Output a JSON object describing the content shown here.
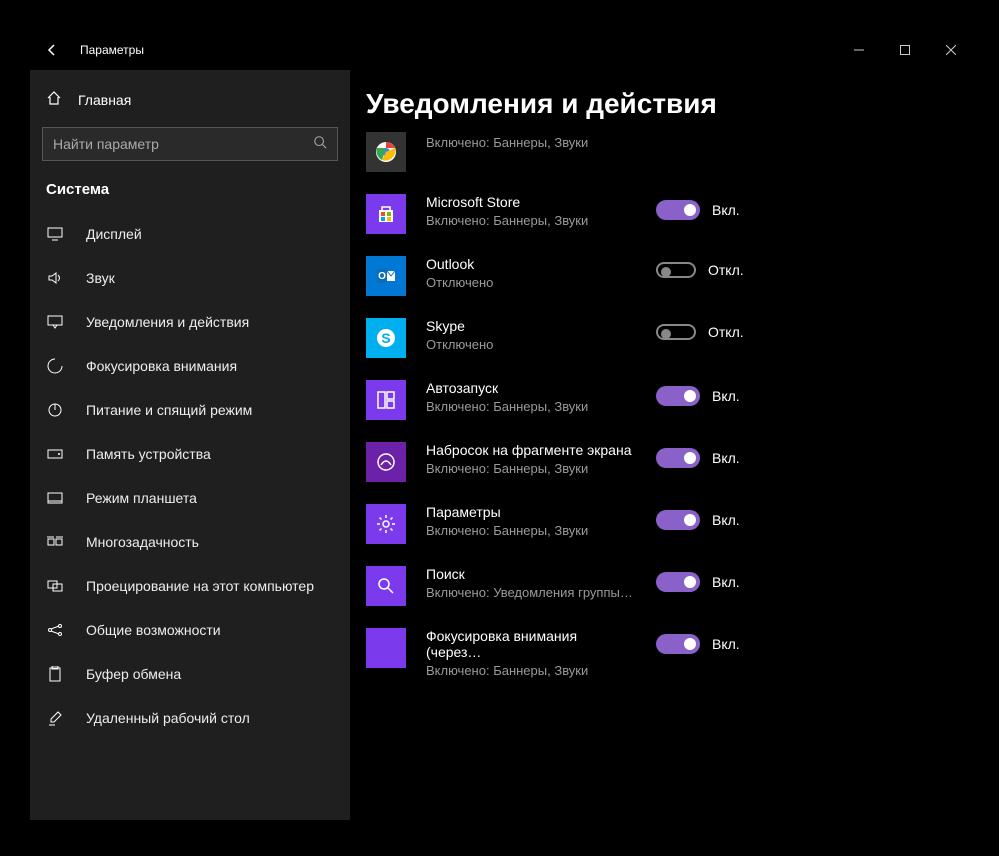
{
  "titlebar": {
    "title": "Параметры"
  },
  "sidebar": {
    "home": "Главная",
    "search_placeholder": "Найти параметр",
    "section": "Система",
    "items": [
      {
        "label": "Дисплей"
      },
      {
        "label": "Звук"
      },
      {
        "label": "Уведомления и действия"
      },
      {
        "label": "Фокусировка внимания"
      },
      {
        "label": "Питание и спящий режим"
      },
      {
        "label": "Память устройства"
      },
      {
        "label": "Режим планшета"
      },
      {
        "label": "Многозадачность"
      },
      {
        "label": "Проецирование на этот компьютер"
      },
      {
        "label": "Общие возможности"
      },
      {
        "label": "Буфер обмена"
      },
      {
        "label": "Удаленный рабочий стол"
      }
    ]
  },
  "page": {
    "title": "Уведомления и действия"
  },
  "toggle_on": "Вкл.",
  "toggle_off": "Откл.",
  "apps": [
    {
      "name": "",
      "sub": "Включено: Баннеры, Звуки",
      "on": true,
      "partial": true
    },
    {
      "name": "Microsoft Store",
      "sub": "Включено: Баннеры, Звуки",
      "on": true
    },
    {
      "name": "Outlook",
      "sub": "Отключено",
      "on": false
    },
    {
      "name": "Skype",
      "sub": "Отключено",
      "on": false
    },
    {
      "name": "Автозапуск",
      "sub": "Включено: Баннеры, Звуки",
      "on": true
    },
    {
      "name": "Набросок на фрагменте экрана",
      "sub": "Включено: Баннеры, Звуки",
      "on": true
    },
    {
      "name": "Параметры",
      "sub": "Включено: Баннеры, Звуки",
      "on": true
    },
    {
      "name": "Поиск",
      "sub": "Включено: Уведомления группы…",
      "on": true
    },
    {
      "name": "Фокусировка внимания (через…",
      "sub": "Включено: Баннеры, Звуки",
      "on": true
    }
  ]
}
